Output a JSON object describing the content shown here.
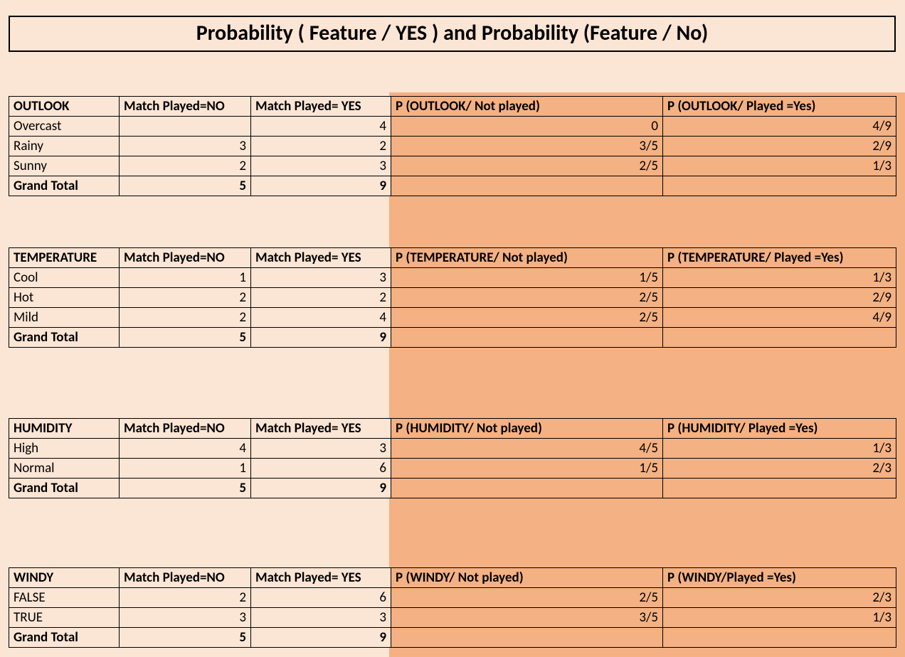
{
  "title": "Probability ( Feature / YES ) and Probability (Feature / No)",
  "headers_common": {
    "no": "Match Played=NO",
    "yes": "Match Played= YES"
  },
  "tables": [
    {
      "feature": "OUTLOOK",
      "p_no_header": "P (OUTLOOK/ Not played)",
      "p_yes_header": "P (OUTLOOK/ Played =Yes)",
      "rows": [
        {
          "label": "Overcast",
          "no": "",
          "yes": "4",
          "pno": "0",
          "pyes": "4/9"
        },
        {
          "label": "Rainy",
          "no": "3",
          "yes": "2",
          "pno": "3/5",
          "pyes": "2/9"
        },
        {
          "label": "Sunny",
          "no": "2",
          "yes": "3",
          "pno": "2/5",
          "pyes": "1/3"
        }
      ],
      "total": {
        "label": "Grand Total",
        "no": "5",
        "yes": "9",
        "pno": "",
        "pyes": ""
      }
    },
    {
      "feature": "TEMPERATURE",
      "p_no_header": "P (TEMPERATURE/ Not played)",
      "p_yes_header": "P (TEMPERATURE/ Played =Yes)",
      "rows": [
        {
          "label": "Cool",
          "no": "1",
          "yes": "3",
          "pno": "1/5",
          "pyes": "1/3"
        },
        {
          "label": "Hot",
          "no": "2",
          "yes": "2",
          "pno": "2/5",
          "pyes": "2/9"
        },
        {
          "label": "Mild",
          "no": "2",
          "yes": "4",
          "pno": "2/5",
          "pyes": "4/9"
        }
      ],
      "total": {
        "label": "Grand Total",
        "no": "5",
        "yes": "9",
        "pno": "",
        "pyes": ""
      }
    },
    {
      "feature": "HUMIDITY",
      "p_no_header": "P (HUMIDITY/ Not played)",
      "p_yes_header": "P (HUMIDITY/ Played =Yes)",
      "rows": [
        {
          "label": "High",
          "no": "4",
          "yes": "3",
          "pno": "4/5",
          "pyes": "1/3"
        },
        {
          "label": "Normal",
          "no": "1",
          "yes": "6",
          "pno": "1/5",
          "pyes": "2/3"
        }
      ],
      "total": {
        "label": "Grand Total",
        "no": "5",
        "yes": "9",
        "pno": "",
        "pyes": ""
      }
    },
    {
      "feature": "WINDY",
      "p_no_header": "P (WINDY/ Not played)",
      "p_yes_header": "P (WINDY/Played =Yes)",
      "rows": [
        {
          "label": "FALSE",
          "no": "2",
          "yes": "6",
          "pno": "2/5",
          "pyes": "2/3"
        },
        {
          "label": "TRUE",
          "no": "3",
          "yes": "3",
          "pno": "3/5",
          "pyes": "1/3"
        }
      ],
      "total": {
        "label": "Grand Total",
        "no": "5",
        "yes": "9",
        "pno": "",
        "pyes": ""
      }
    }
  ]
}
